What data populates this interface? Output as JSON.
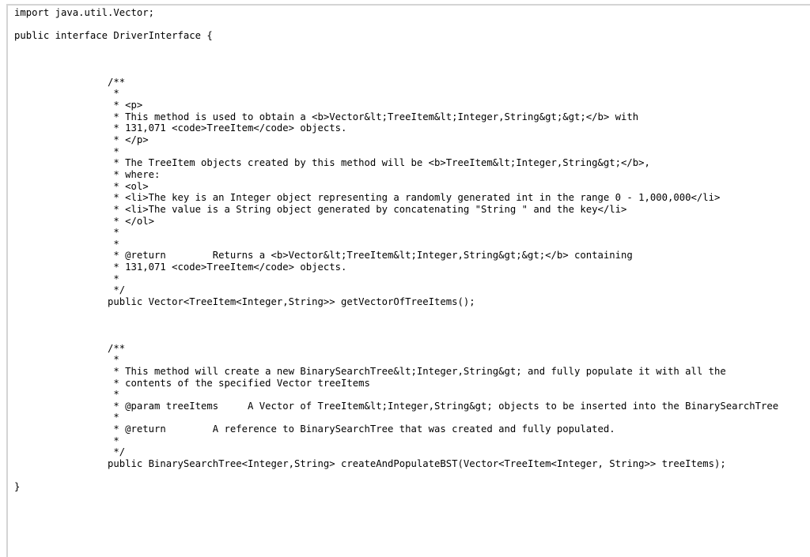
{
  "document": {
    "type": "java-source",
    "lines": [
      "import java.util.Vector;",
      "",
      "public interface DriverInterface {",
      "",
      "",
      "",
      "                /**",
      "                 *",
      "                 * <p>",
      "                 * This method is used to obtain a <b>Vector&lt;TreeItem&lt;Integer,String&gt;&gt;</b> with",
      "                 * 131,071 <code>TreeItem</code> objects.",
      "                 * </p>",
      "                 *",
      "                 * The TreeItem objects created by this method will be <b>TreeItem&lt;Integer,String&gt;</b>,",
      "                 * where:",
      "                 * <ol>",
      "                 * <li>The key is an Integer object representing a randomly generated int in the range 0 - 1,000,000</li>",
      "                 * <li>The value is a String object generated by concatenating \"String \" and the key</li>",
      "                 * </ol>",
      "                 *",
      "                 *",
      "                 * @return        Returns a <b>Vector&lt;TreeItem&lt;Integer,String&gt;&gt;</b> containing",
      "                 * 131,071 <code>TreeItem</code> objects.",
      "                 *",
      "                 */",
      "                public Vector<TreeItem<Integer,String>> getVectorOfTreeItems();",
      "",
      "",
      "",
      "                /**",
      "                 *",
      "                 * This method will create a new BinarySearchTree&lt;Integer,String&gt; and fully populate it with all the",
      "                 * contents of the specified Vector treeItems",
      "                 *",
      "                 * @param treeItems     A Vector of TreeItem&lt;Integer,String&gt; objects to be inserted into the BinarySearchTree",
      "                 *",
      "                 * @return        A reference to BinarySearchTree that was created and fully populated.",
      "                 *",
      "                 */",
      "                public BinarySearchTree<Integer,String> createAndPopulateBST(Vector<TreeItem<Integer, String>> treeItems);",
      "",
      "}"
    ]
  }
}
